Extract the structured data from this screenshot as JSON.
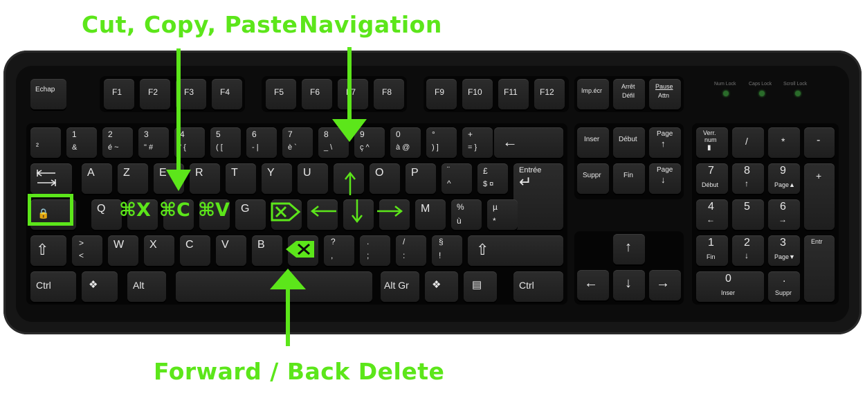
{
  "annotations": {
    "cut_copy_paste": "Cut, Copy, Paste",
    "navigation": "Navigation",
    "delete": "Forward / Back Delete"
  },
  "shortcuts": {
    "cut": "⌘X",
    "copy": "⌘C",
    "paste": "⌘V"
  },
  "leds": [
    "Num Lock",
    "Caps Lock",
    "Scroll Lock"
  ],
  "keys": {
    "esc": "Echap",
    "f1": "F1",
    "f2": "F2",
    "f3": "F3",
    "f4": "F4",
    "f5": "F5",
    "f6": "F6",
    "f7": "F7",
    "f8": "F8",
    "f9": "F9",
    "f10": "F10",
    "f11": "F11",
    "f12": "F12",
    "print": "Imp.écr",
    "scroll_top": "Arrêt",
    "scroll_bot": "Défil",
    "pause_top": "Pause",
    "pause_bot": "Attn",
    "a": "A",
    "z": "Z",
    "e": "E",
    "r": "R",
    "t": "T",
    "y": "Y",
    "u": "U",
    "o": "O",
    "p": "P",
    "q": "Q",
    "g": "G",
    "m": "M",
    "w": "W",
    "x": "X",
    "c": "C",
    "v": "V",
    "b": "B",
    "enter": "Entrée",
    "ctrl": "Ctrl",
    "alt": "Alt",
    "altgr": "Alt Gr",
    "ctrl_r": "Ctrl",
    "insert": "Inser",
    "home": "Début",
    "page": "Page",
    "delete": "Suppr",
    "end": "Fin",
    "numlock_top": "Verr.",
    "numlock_bot": "num",
    "slash": "/",
    "star": "*",
    "minus": "-",
    "plus": "+",
    "n7": "7",
    "n8": "8",
    "n9": "9",
    "n4": "4",
    "n5": "5",
    "n6": "6",
    "n1": "1",
    "n2": "2",
    "n3": "3",
    "n0": "0",
    "n7_sub": "Début",
    "n9_sub": "Page▲",
    "n1_sub": "Fin",
    "n3_sub": "Page▼",
    "n0_sub": "Inser",
    "ndot": ".",
    "ndot_sub": "Suppr",
    "nenter": "Entr"
  },
  "number_row": [
    [
      "1",
      "&"
    ],
    [
      "2",
      "é ~"
    ],
    [
      "3",
      "\" #"
    ],
    [
      "4",
      "' {"
    ],
    [
      "5",
      "( ["
    ],
    [
      "6",
      "- |"
    ],
    [
      "7",
      "è `"
    ],
    [
      "8",
      "_ \\"
    ],
    [
      "9",
      "ç ^"
    ],
    [
      "0",
      "à @"
    ],
    [
      "°",
      ") ]"
    ],
    [
      "+",
      "= }"
    ]
  ],
  "misc_keys": {
    "superscript2": "²",
    "diaeresis": "¨",
    "caret": "^",
    "pound": "£",
    "dollar_cur": "$ ¤",
    "percent": "%",
    "u_grave": "ù",
    "mu": "µ",
    "asterisk": "*",
    "lt": ">",
    "gt": "<",
    "question": "?",
    "comma": ",",
    "period": ".",
    "semicolon": ";",
    "slash2": "/",
    "colon": ":",
    "section": "§",
    "exclam": "!"
  }
}
